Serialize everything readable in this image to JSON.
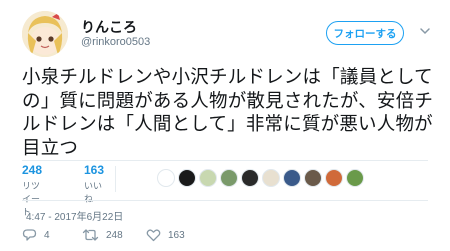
{
  "user": {
    "display_name": "りんころ",
    "handle": "@rinkoro0503"
  },
  "follow_button_label": "フォローする",
  "tweet_text": "小泉チルドレンや小沢チルドレンは「議員としての」質に問題がある人物が散見されたが、安倍チルドレンは「人間として」非常に質が悪い人物が目立つ",
  "stats": {
    "retweets": {
      "count": "248",
      "label": "リツイート"
    },
    "likes": {
      "count": "163",
      "label": "いいね"
    }
  },
  "likers": [
    {
      "icon": "liker-avatar-1",
      "color": "#ffffff"
    },
    {
      "icon": "liker-avatar-2",
      "color": "#1a1a1a"
    },
    {
      "icon": "liker-avatar-3",
      "color": "#c8d8b0"
    },
    {
      "icon": "liker-avatar-4",
      "color": "#7a9a6a"
    },
    {
      "icon": "liker-avatar-5",
      "color": "#2a2a2a"
    },
    {
      "icon": "liker-avatar-6",
      "color": "#e8e0d0"
    },
    {
      "icon": "liker-avatar-7",
      "color": "#3a5a8a"
    },
    {
      "icon": "liker-avatar-8",
      "color": "#6a5a4a"
    },
    {
      "icon": "liker-avatar-9",
      "color": "#d06a3a"
    },
    {
      "icon": "liker-avatar-10",
      "color": "#6a9a4a"
    }
  ],
  "timestamp": "4:47 - 2017年6月22日",
  "actions": {
    "reply_count": "4",
    "retweet_count": "248",
    "like_count": "163"
  },
  "colors": {
    "accent": "#1da1f2",
    "count_blue": "#1c94e0",
    "muted": "#657786",
    "divider": "#e6ecf0"
  }
}
